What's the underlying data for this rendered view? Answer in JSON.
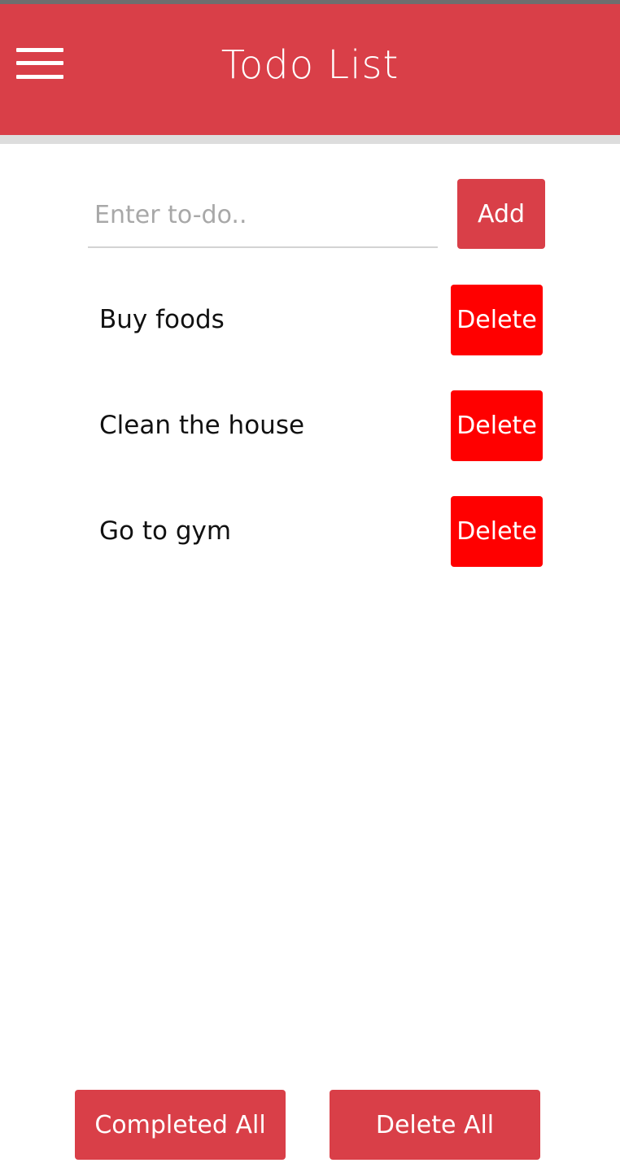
{
  "app_bar": {
    "title": "Todo List",
    "menu_icon": "hamburger-menu-icon"
  },
  "input": {
    "placeholder": "Enter to-do..",
    "value": ""
  },
  "add_button": {
    "label": "Add"
  },
  "todos": [
    {
      "text": "Buy foods",
      "delete_label": "Delete"
    },
    {
      "text": "Clean the house",
      "delete_label": "Delete"
    },
    {
      "text": "Go to gym",
      "delete_label": "Delete"
    }
  ],
  "footer": {
    "completed_all_label": "Completed All",
    "delete_all_label": "Delete All"
  },
  "colors": {
    "primary": "#d93f48",
    "delete": "#ff0000",
    "background": "#ffffff"
  }
}
